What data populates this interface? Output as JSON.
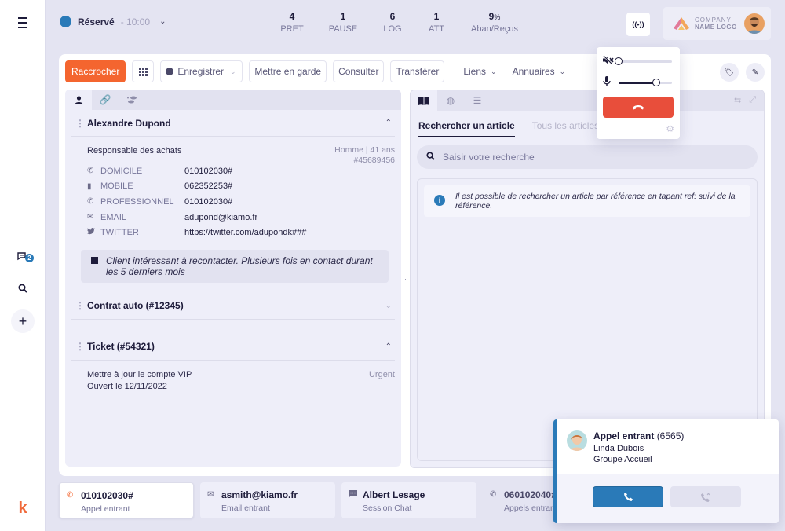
{
  "sidebar": {
    "chat_badge": "2",
    "logo_letter": "k"
  },
  "topbar": {
    "status_label": "Réservé",
    "status_time": "- 10:00",
    "status_color": "#2a7ab8",
    "stats": [
      {
        "value": "4",
        "unit": "",
        "label": "PRET"
      },
      {
        "value": "1",
        "unit": "",
        "label": "PAUSE"
      },
      {
        "value": "6",
        "unit": "",
        "label": "LOG"
      },
      {
        "value": "1",
        "unit": "",
        "label": "ATT"
      },
      {
        "value": "9",
        "unit": "%",
        "label": "Aban/Reçus"
      }
    ],
    "broadcast_icon": "((•))",
    "company_line1": "COMPANY",
    "company_line2": "NAME LOGO"
  },
  "toolbar": {
    "hangup_label": "Raccrocher",
    "record_label": "Enregistrer",
    "hold_label": "Mettre en garde",
    "consult_label": "Consulter",
    "transfer_label": "Transférer",
    "links_label": "Liens",
    "directories_label": "Annuaires",
    "accent_color": "#f4652f"
  },
  "contact": {
    "name": "Alexandre Dupond",
    "role": "Responsable des achats",
    "gender_age": "Homme | 41 ans",
    "id": "#45689456",
    "fields": [
      {
        "icon": "phone-icon",
        "glyph": "✆",
        "key": "DOMICILE",
        "value": "010102030#"
      },
      {
        "icon": "mobile-icon",
        "glyph": "▮",
        "key": "MOBILE",
        "value": "062352253#"
      },
      {
        "icon": "phone-icon",
        "glyph": "✆",
        "key": "PROFESSIONNEL",
        "value": "010102030#"
      },
      {
        "icon": "email-icon",
        "glyph": "✉",
        "key": "EMAIL",
        "value": "adupond@kiamo.fr"
      },
      {
        "icon": "twitter-icon",
        "glyph": "🐦",
        "key": "TWITTER",
        "value": "https://twitter.com/adupondk###"
      }
    ],
    "note": "Client intéressant à recontacter. Plusieurs fois en contact durant les 5 derniers mois"
  },
  "contract": {
    "title": "Contrat auto (#12345)"
  },
  "ticket": {
    "title": "Ticket (#54321)",
    "line1": "Mettre à jour le compte VIP",
    "line2": "Ouvert le 12/11/2022",
    "priority": "Urgent"
  },
  "knowledge": {
    "tabs": [
      {
        "label": "Rechercher un article",
        "active": true
      },
      {
        "label": "Tous les articles",
        "active": false
      }
    ],
    "search_placeholder": "Saisir votre recherche",
    "info_text": "Il est possible de rechercher un article par référence en tapant ref: suivi de la référence."
  },
  "audio": {
    "speaker_volume": 0.0,
    "speaker_muted": true,
    "mic_volume": 0.7,
    "hangup_color": "#e84e3b"
  },
  "conversations": [
    {
      "icon": "phone-icon",
      "glyph": "✆",
      "title": "010102030#",
      "subtitle": "Appel entrant",
      "active": true
    },
    {
      "icon": "email-icon",
      "glyph": "✉",
      "title": "asmith@kiamo.fr",
      "subtitle": "Email entrant",
      "active": false
    },
    {
      "icon": "chat-icon",
      "glyph": "▪",
      "title": "Albert Lesage",
      "subtitle": "Session Chat",
      "active": false
    },
    {
      "icon": "phone-icon",
      "glyph": "✆",
      "title": "060102040#",
      "subtitle": "Appels entrants",
      "active": false
    }
  ],
  "incoming_call": {
    "title": "Appel entrant",
    "number": "(6565)",
    "caller": "Linda Dubois",
    "group": "Groupe Accueil",
    "accent_color": "#2a7ab8"
  }
}
